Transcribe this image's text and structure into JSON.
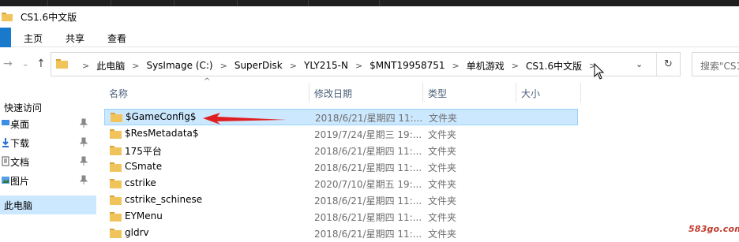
{
  "window": {
    "title": "CS1.6中文版"
  },
  "ribbon": {
    "tabs": [
      "主页",
      "共享",
      "查看"
    ]
  },
  "address": {
    "crumbs": [
      "此电脑",
      "SysImage (C:)",
      "SuperDisk",
      "YLY215-N",
      "$MNT19958751",
      "单机游戏",
      "CS1.6中文版"
    ]
  },
  "search": {
    "placeholder": "搜索\"CS1"
  },
  "sidebar": {
    "items": [
      {
        "label": "快速访问",
        "pinned": false,
        "icon": "star-icon"
      },
      {
        "label": "桌面",
        "pinned": true,
        "icon": "desktop-icon"
      },
      {
        "label": "下载",
        "pinned": true,
        "icon": "download-icon"
      },
      {
        "label": "文档",
        "pinned": true,
        "icon": "document-icon"
      },
      {
        "label": "图片",
        "pinned": true,
        "icon": "picture-icon"
      },
      {
        "label": "此电脑",
        "pinned": false,
        "icon": "computer-icon"
      }
    ]
  },
  "columns": {
    "name": "名称",
    "date": "修改日期",
    "type": "类型",
    "size": "大小"
  },
  "files": [
    {
      "name": "$GameConfig$",
      "date": "2018/6/21/星期四 11:...",
      "type": "文件夹",
      "selected": true
    },
    {
      "name": "$ResMetadata$",
      "date": "2019/7/24/星期三 19:...",
      "type": "文件夹",
      "selected": false
    },
    {
      "name": "175平台",
      "date": "2018/6/21/星期四 11:...",
      "type": "文件夹",
      "selected": false
    },
    {
      "name": "CSmate",
      "date": "2018/6/21/星期四 11:...",
      "type": "文件夹",
      "selected": false
    },
    {
      "name": "cstrike",
      "date": "2020/7/10/星期五 19:...",
      "type": "文件夹",
      "selected": false
    },
    {
      "name": "cstrike_schinese",
      "date": "2018/6/21/星期四 11:...",
      "type": "文件夹",
      "selected": false
    },
    {
      "name": "EYMenu",
      "date": "2018/6/21/星期四 11:...",
      "type": "文件夹",
      "selected": false
    },
    {
      "name": "gldrv",
      "date": "2018/6/21/星期四 11:...",
      "type": "文件夹",
      "selected": false
    }
  ],
  "watermark": "583go.com",
  "colors": {
    "accent": "#1979ca",
    "selection": "#cce8ff",
    "folder": "#e8b84a",
    "annotation": "#e02020"
  }
}
